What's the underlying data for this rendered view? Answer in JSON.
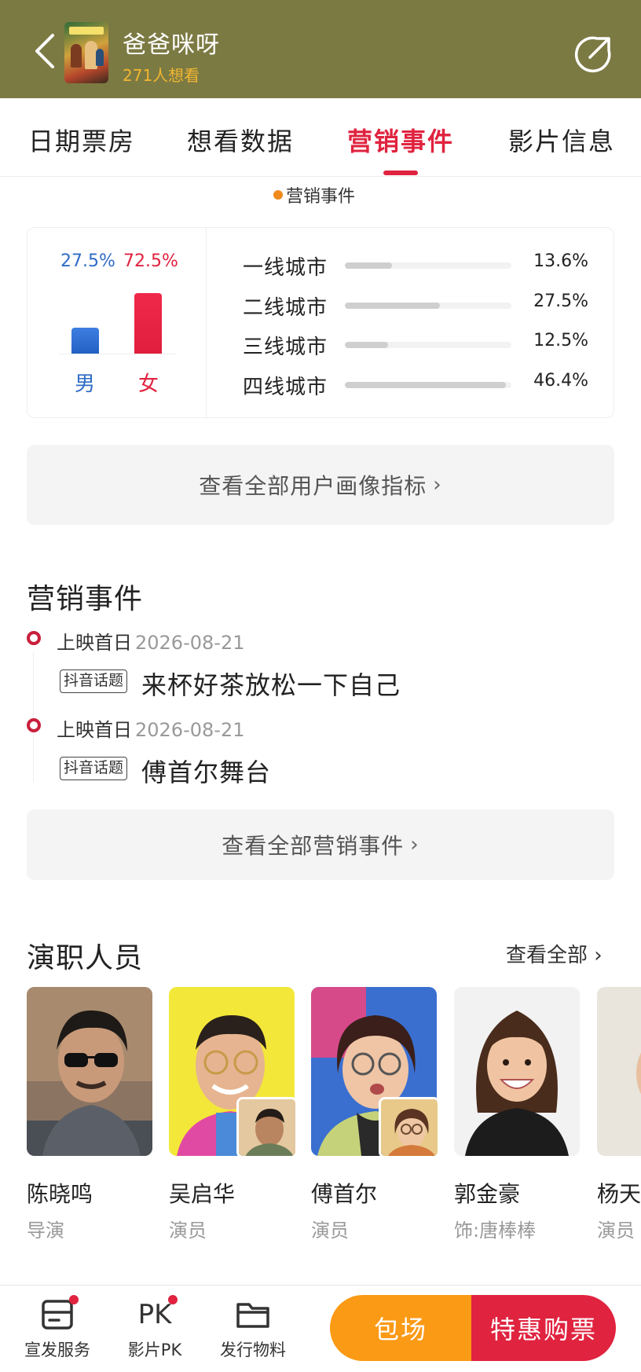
{
  "header": {
    "title": "爸爸咪呀",
    "want_count": "271人想看",
    "back_icon": "back-arrow-icon",
    "share_icon": "share-icon",
    "background": "#7c7a43"
  },
  "tabs": [
    {
      "label": "日期票房"
    },
    {
      "label": "想看数据"
    },
    {
      "label": "营销事件",
      "active": true
    },
    {
      "label": "影片信息"
    }
  ],
  "legend": {
    "label": "营销事件",
    "color": "#f08a1c"
  },
  "gender": {
    "male": {
      "label": "男",
      "pct_text": "27.5%",
      "value": 27.5,
      "color": "#2f6cc6"
    },
    "female": {
      "label": "女",
      "pct_text": "72.5%",
      "value": 72.5,
      "color": "#e0233f"
    }
  },
  "cities": [
    {
      "name": "一线城市",
      "pct_text": "13.6%",
      "value": 13.6
    },
    {
      "name": "二线城市",
      "pct_text": "27.5%",
      "value": 27.5
    },
    {
      "name": "三线城市",
      "pct_text": "12.5%",
      "value": 12.5
    },
    {
      "name": "四线城市",
      "pct_text": "46.4%",
      "value": 46.4
    }
  ],
  "view_all_profile": "查看全部用户画像指标",
  "marketing": {
    "title": "营销事件",
    "events": [
      {
        "label": "上映首日",
        "date": "2026-08-21",
        "tag": "抖音话题",
        "text": "来杯好茶放松一下自己"
      },
      {
        "label": "上映首日",
        "date": "2026-08-21",
        "tag": "抖音话题",
        "text": "傅首尔舞台"
      }
    ],
    "view_all": "查看全部营销事件"
  },
  "cast": {
    "title": "演职人员",
    "see_all": "查看全部",
    "members": [
      {
        "name": "陈晓鸣",
        "role": "导演"
      },
      {
        "name": "吴启华",
        "role": "演员"
      },
      {
        "name": "傅首尔",
        "role": "演员"
      },
      {
        "name": "郭金豪",
        "role": "饰:唐棒棒"
      },
      {
        "name": "杨天",
        "role": "演员"
      }
    ]
  },
  "bottom_nav": [
    {
      "label": "宣发服务",
      "icon": "service-icon"
    },
    {
      "label": "影片PK",
      "icon": "pk-icon",
      "icon_text": "PK"
    },
    {
      "label": "发行物料",
      "icon": "folder-icon"
    }
  ],
  "actions": {
    "book_label": "包场",
    "buy_label": "特惠购票",
    "book_color": "#fb9a15",
    "buy_color": "#e0233f"
  }
}
